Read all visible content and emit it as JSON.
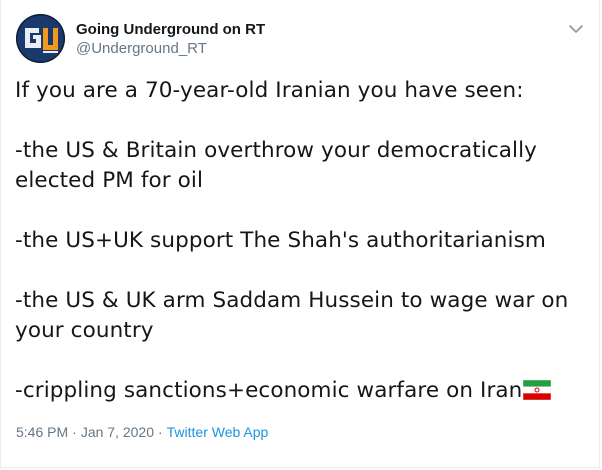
{
  "author": {
    "display_name": "Going Underground on RT",
    "handle": "@Underground_RT",
    "avatar_initials": "GU"
  },
  "tweet": {
    "paragraphs": [
      "If you are a 70-year-old Iranian you have seen:",
      "-the US & Britain overthrow your democratically elected PM for oil",
      "-the US+UK support The Shah's authoritarianism",
      "-the US & UK arm Saddam Hussein to wage war on your country",
      "-crippling sanctions+economic warfare on Iran"
    ],
    "emoji": "iran-flag-icon"
  },
  "meta": {
    "time": "5:46 PM",
    "date": "Jan 7, 2020",
    "separator": "·",
    "source": "Twitter Web App"
  },
  "colors": {
    "text": "#14171a",
    "secondary": "#657786",
    "link": "#1b95e0"
  }
}
